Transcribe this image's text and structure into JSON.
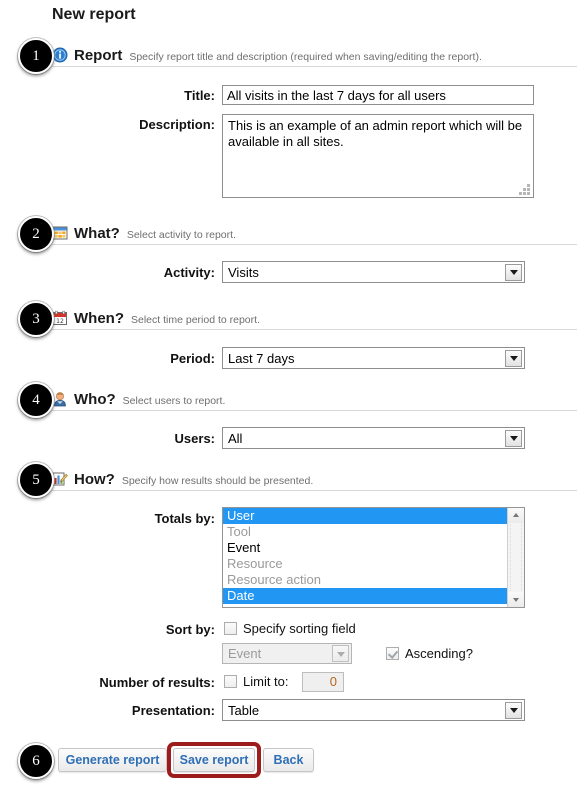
{
  "page": {
    "title": "New report"
  },
  "sections": [
    {
      "badge": "1",
      "icon": "info-icon",
      "title": "Report",
      "desc": "Specify report title and description (required when saving/editing the report)."
    },
    {
      "badge": "2",
      "icon": "table-grid-icon",
      "title": "What?",
      "desc": "Select activity to report."
    },
    {
      "badge": "3",
      "icon": "calendar-icon",
      "title": "When?",
      "desc": "Select time period to report."
    },
    {
      "badge": "4",
      "icon": "user-icon",
      "title": "Who?",
      "desc": "Select users to report."
    },
    {
      "badge": "5",
      "icon": "chart-pencil-icon",
      "title": "How?",
      "desc": "Specify how results should be presented."
    }
  ],
  "fields": {
    "title": {
      "label": "Title:",
      "value": "All visits in the last 7 days for all users"
    },
    "description": {
      "label": "Description:",
      "value": "This is an example of an admin report which will be available in all sites."
    },
    "activity": {
      "label": "Activity:",
      "value": "Visits"
    },
    "period": {
      "label": "Period:",
      "value": "Last 7 days"
    },
    "users": {
      "label": "Users:",
      "value": "All"
    },
    "totals_by": {
      "label": "Totals by:",
      "options": [
        {
          "label": "User",
          "state": "selected"
        },
        {
          "label": "Tool",
          "state": "disabled"
        },
        {
          "label": "Event",
          "state": "normal"
        },
        {
          "label": "Resource",
          "state": "disabled"
        },
        {
          "label": "Resource action",
          "state": "disabled"
        },
        {
          "label": "Date",
          "state": "selected"
        }
      ]
    },
    "sort_by": {
      "label": "Sort by:",
      "checkbox_label": "Specify sorting field",
      "checked": false,
      "select_value": "Event",
      "ascending_label": "Ascending?",
      "ascending_checked": true
    },
    "number_of_results": {
      "label": "Number of results:",
      "checkbox_label": "Limit to:",
      "checked": false,
      "value": "0"
    },
    "presentation": {
      "label": "Presentation:",
      "value": "Table"
    }
  },
  "actions": {
    "badge": "6",
    "buttons": [
      {
        "label": "Generate report",
        "highlighted": false
      },
      {
        "label": "Save report",
        "highlighted": true
      },
      {
        "label": "Back",
        "highlighted": false
      }
    ]
  },
  "colors": {
    "selection_blue": "#2196f3",
    "annotation_red": "#9e1b1b",
    "button_text": "#2f6fb5",
    "muted_text": "#6e6e6e"
  }
}
